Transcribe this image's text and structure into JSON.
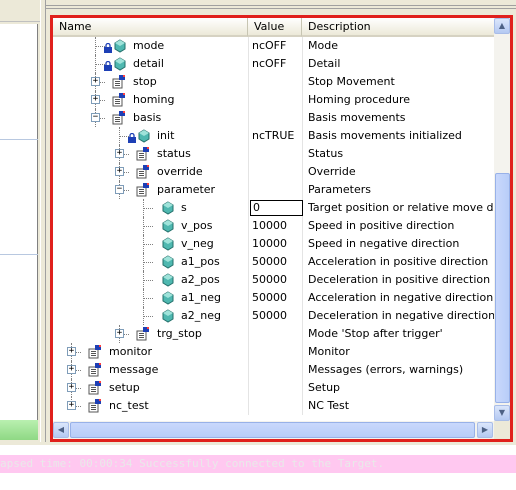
{
  "tree": {
    "columns": {
      "name": "Name",
      "value": "Value",
      "description": "Description"
    },
    "rows": [
      {
        "name": "mode",
        "value": "ncOFF",
        "desc": "Mode",
        "depth": 2,
        "icon": "param-lock",
        "expander": "none"
      },
      {
        "name": "detail",
        "value": "ncOFF",
        "desc": "Detail",
        "depth": 2,
        "icon": "param-lock",
        "expander": "none"
      },
      {
        "name": "stop",
        "value": "",
        "desc": "Stop Movement",
        "depth": 2,
        "icon": "struct",
        "expander": "+"
      },
      {
        "name": "homing",
        "value": "",
        "desc": "Homing procedure",
        "depth": 2,
        "icon": "struct",
        "expander": "+"
      },
      {
        "name": "basis",
        "value": "",
        "desc": "Basis movements",
        "depth": 2,
        "icon": "struct",
        "expander": "-"
      },
      {
        "name": "init",
        "value": "ncTRUE",
        "desc": "Basis movements initialized",
        "depth": 3,
        "icon": "param-lock",
        "expander": "none"
      },
      {
        "name": "status",
        "value": "",
        "desc": "Status",
        "depth": 3,
        "icon": "struct",
        "expander": "+"
      },
      {
        "name": "override",
        "value": "",
        "desc": "Override",
        "depth": 3,
        "icon": "struct",
        "expander": "+"
      },
      {
        "name": "parameter",
        "value": "",
        "desc": "Parameters",
        "depth": 3,
        "icon": "struct",
        "expander": "-"
      },
      {
        "name": "s",
        "value": "0",
        "desc": "Target position or relative move distance",
        "depth": 4,
        "icon": "param",
        "expander": "none",
        "editing": true
      },
      {
        "name": "v_pos",
        "value": "10000",
        "desc": "Speed in positive direction",
        "depth": 4,
        "icon": "param",
        "expander": "none"
      },
      {
        "name": "v_neg",
        "value": "10000",
        "desc": "Speed in negative direction",
        "depth": 4,
        "icon": "param",
        "expander": "none"
      },
      {
        "name": "a1_pos",
        "value": "50000",
        "desc": "Acceleration in positive direction",
        "depth": 4,
        "icon": "param",
        "expander": "none"
      },
      {
        "name": "a2_pos",
        "value": "50000",
        "desc": "Deceleration in positive direction",
        "depth": 4,
        "icon": "param",
        "expander": "none"
      },
      {
        "name": "a1_neg",
        "value": "50000",
        "desc": "Acceleration in negative direction",
        "depth": 4,
        "icon": "param",
        "expander": "none"
      },
      {
        "name": "a2_neg",
        "value": "50000",
        "desc": "Deceleration in negative direction",
        "depth": 4,
        "icon": "param",
        "expander": "none"
      },
      {
        "name": "trg_stop",
        "value": "",
        "desc": "Mode 'Stop after trigger'",
        "depth": 3,
        "icon": "struct",
        "expander": "+"
      },
      {
        "name": "monitor",
        "value": "",
        "desc": "Monitor",
        "depth": 1,
        "icon": "struct",
        "expander": "+"
      },
      {
        "name": "message",
        "value": "",
        "desc": "Messages (errors, warnings)",
        "depth": 1,
        "icon": "struct",
        "expander": "+"
      },
      {
        "name": "setup",
        "value": "",
        "desc": "Setup",
        "depth": 1,
        "icon": "struct",
        "expander": "+"
      },
      {
        "name": "nc_test",
        "value": "",
        "desc": "NC Test",
        "depth": 1,
        "icon": "struct",
        "expander": "+"
      }
    ]
  },
  "status": {
    "text": "apsed time: 00:00:34  Successfully connected to the Target."
  },
  "colors": {
    "highlight_frame": "#e0201c",
    "status_bg": "#ffc8f0",
    "left_green": "#a6e59a"
  },
  "icons": [
    "lock-icon",
    "cube-icon",
    "structure-icon",
    "expand-icon",
    "collapse-icon",
    "scroll-up-icon",
    "scroll-down-icon",
    "scroll-left-icon",
    "scroll-right-icon"
  ]
}
